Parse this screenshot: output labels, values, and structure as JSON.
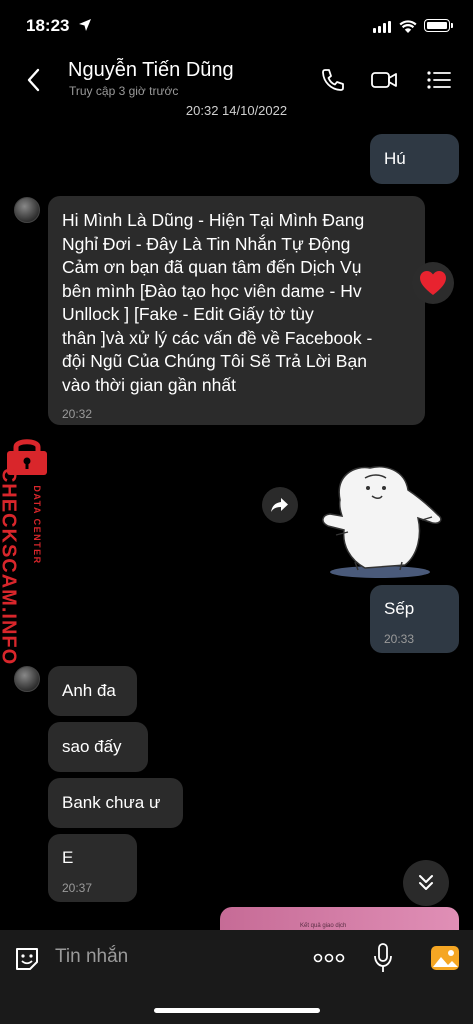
{
  "status_bar": {
    "time": "18:23"
  },
  "header": {
    "contact_name": "Nguyễn Tiến Dũng",
    "subtitle": "Truy cập 3 giờ trước"
  },
  "messages": {
    "date_stamp": "20:32 14/10/2022",
    "m1_text": "Hú",
    "m2_lines": [
      "Hi Mình Là Dũng - Hiện Tại Mình Đang",
      "Nghỉ Đơi - Đây Là Tin Nhắn Tự Động",
      "Cảm ơn bạn đã quan tâm đến Dịch Vụ",
      "bên mình [Đào tạo học viên dame - Hv",
      "Unllock ] [Fake - Edit Giấy tờ tùy",
      "thân ]và xử lý các vấn đề về Facebook  -",
      "đội Ngũ Của Chúng Tôi Sẽ Trả Lời Bạn",
      "vào thời gian gần nhất"
    ],
    "m2_time": "20:32",
    "m4_text": "Sếp",
    "m4_time": "20:33",
    "m5_text": "Anh đa",
    "m6_text": "sao đấy",
    "m7_text": "Bank chưa ư",
    "m8_text": "E",
    "m8_time": "20:37",
    "preview_caption": "Kết quả giao dịch"
  },
  "watermark": {
    "brand": "CHECKSCAM.INFO",
    "sub": "DATA CENTER",
    "color": "#d9262b"
  },
  "input_bar": {
    "placeholder": "Tin nhắn"
  },
  "icons": [
    "back-icon",
    "phone-icon",
    "video-icon",
    "menu-icon",
    "heart-icon",
    "forward-icon",
    "chevron-down-icon",
    "sticker-icon",
    "more-icon",
    "mic-icon",
    "image-icon"
  ]
}
